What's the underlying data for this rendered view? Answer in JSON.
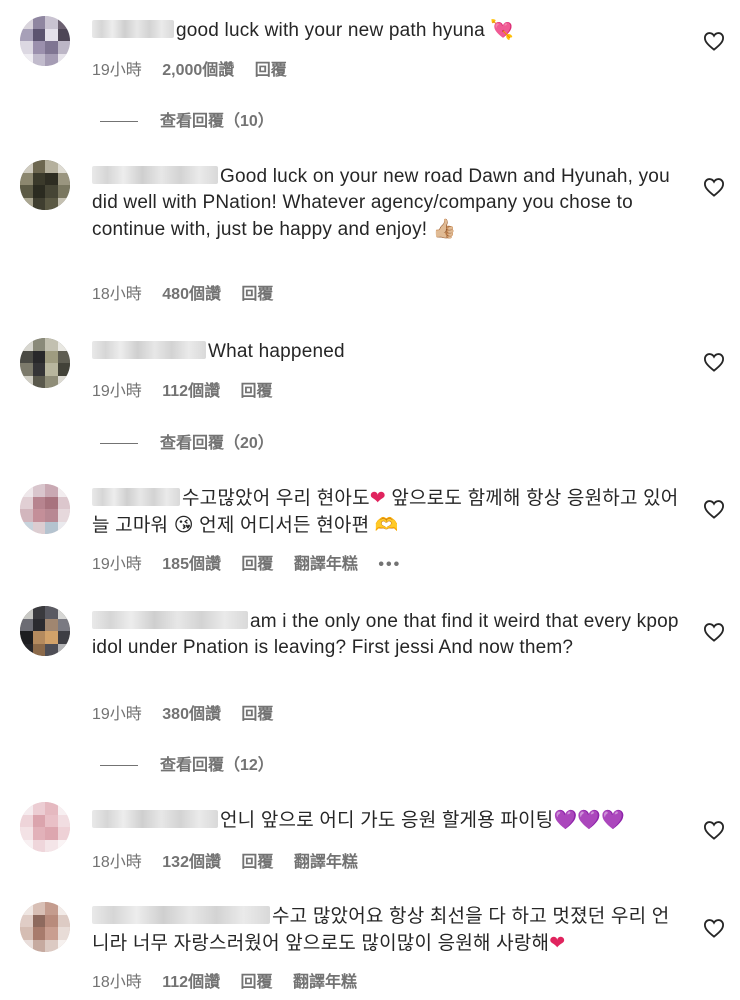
{
  "colors": {
    "text": "#262626",
    "meta": "#737373",
    "heart_icon": "#262626",
    "red_heart": "#e0245e",
    "purple_heart": "#8a2be2"
  },
  "comments": [
    {
      "text": "good luck with your new path hyuna",
      "emoji": "💘",
      "time": "19小時",
      "likes": "2,000個讚",
      "reply": "回覆",
      "view_replies": "查看回覆（10）"
    },
    {
      "text": "Good luck on your new road Dawn and Hyunah, you did well with PNation! Whatever agency/company you chose to continue with, just be happy and enjoy!",
      "emoji": "👍🏼",
      "time": "18小時",
      "likes": "480個讚",
      "reply": "回覆"
    },
    {
      "text": "What happened",
      "time": "19小時",
      "likes": "112個讚",
      "reply": "回覆",
      "view_replies": "查看回覆（20）"
    },
    {
      "text_a": "수고많았어 우리 현아도",
      "emoji_a": "❤",
      "text_b": " 앞으로도 함께해 항상 응원하고 있어 늘 고마워",
      "emoji_b": "😘",
      "text_c": " 언제 어디서든 현아편",
      "emoji_c": "🫶",
      "time": "19小時",
      "likes": "185個讚",
      "reply": "回覆",
      "translate": "翻譯年糕",
      "more": "•••"
    },
    {
      "text": "am i the only one that find it weird that every kpop idol under Pnation is leaving? First jessi And now them?",
      "time": "19小時",
      "likes": "380個讚",
      "reply": "回覆",
      "view_replies": "查看回覆（12）"
    },
    {
      "text": "언니 앞으로 어디 가도 응원 할게용 파이팅",
      "emoji": "💜💜💜",
      "time": "18小時",
      "likes": "132個讚",
      "reply": "回覆",
      "translate": "翻譯年糕"
    },
    {
      "text": "수고 많았어요 항상 최선을 다 하고 멋졌던 우리 언니라 너무 자랑스러웠어 앞으로도 많이많이 응원해 사랑해",
      "emoji": "❤",
      "time": "18小時",
      "likes": "112個讚",
      "reply": "回覆",
      "translate": "翻譯年糕"
    }
  ],
  "icons": {
    "like": "heart-outline-icon"
  }
}
